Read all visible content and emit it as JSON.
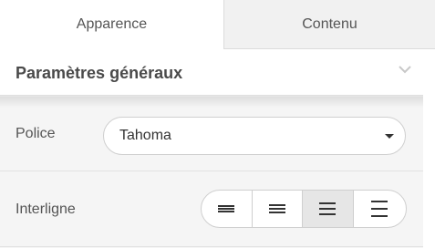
{
  "tabs": [
    {
      "label": "Apparence",
      "active": true
    },
    {
      "label": "Contenu",
      "active": false
    }
  ],
  "section": {
    "title": "Paramètres généraux",
    "toggle_icon": "chevron-down-icon"
  },
  "font_row": {
    "label": "Police",
    "selected_value": "Tahoma",
    "dropdown_icon": "caret-down-icon"
  },
  "line_spacing_row": {
    "label": "Interligne",
    "options": [
      {
        "icon": "line-spacing-tight-icon",
        "selected": false
      },
      {
        "icon": "line-spacing-normal-icon",
        "selected": false
      },
      {
        "icon": "line-spacing-medium-icon",
        "selected": true
      },
      {
        "icon": "line-spacing-wide-icon",
        "selected": false
      }
    ]
  },
  "colors": {
    "inactive_tab_bg": "#f1f1f1",
    "panel_bg": "#f5f5f5",
    "selected_button_bg": "#e6e6e6",
    "border": "#cfcfcf"
  }
}
